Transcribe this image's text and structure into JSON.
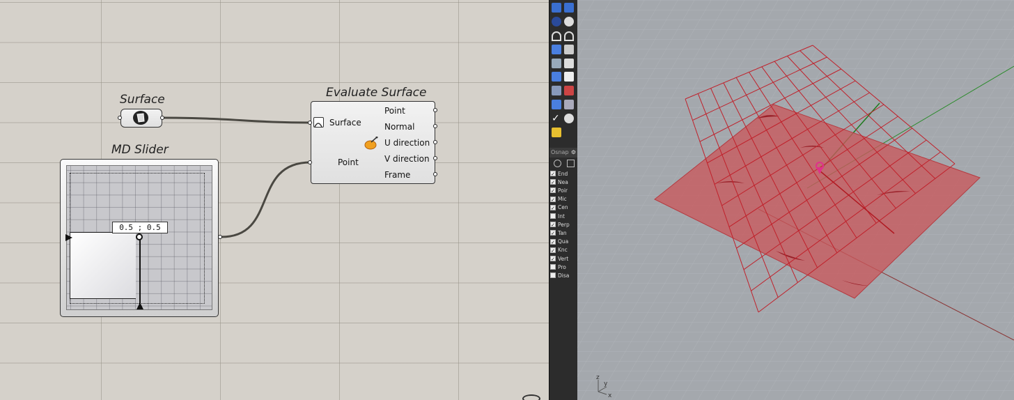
{
  "grasshopper": {
    "surface_component": {
      "title": "Surface"
    },
    "md_slider": {
      "title": "MD Slider",
      "value_text": "0.5 ; 0.5",
      "u_value": 0.5,
      "v_value": 0.5
    },
    "evaluate_surface": {
      "title": "Evaluate Surface",
      "inputs": [
        "Surface",
        "Point"
      ],
      "outputs": [
        "Point",
        "Normal",
        "U direction",
        "V direction",
        "Frame"
      ]
    }
  },
  "rhino": {
    "osnap": {
      "header": "Osnap",
      "items": [
        {
          "label": "End",
          "checked": true
        },
        {
          "label": "Nea",
          "checked": true
        },
        {
          "label": "Poir",
          "checked": true
        },
        {
          "label": "Mic",
          "checked": true
        },
        {
          "label": "Cen",
          "checked": true
        },
        {
          "label": "Int",
          "checked": false
        },
        {
          "label": "Perp",
          "checked": true
        },
        {
          "label": "Tan",
          "checked": true
        },
        {
          "label": "Qua",
          "checked": true
        },
        {
          "label": "Knc",
          "checked": true
        },
        {
          "label": "Vert",
          "checked": true
        },
        {
          "label": "Pro",
          "checked": false
        },
        {
          "label": "Disa",
          "checked": false
        }
      ]
    },
    "viewport": {
      "axis_labels": {
        "z": "z",
        "y": "y",
        "x": "x"
      }
    }
  },
  "colors": {
    "canvas_bg": "#d5d1ca",
    "surface_fill": "#c9585c",
    "grid_red": "#c0202a",
    "toolbar_bg": "#2c2c2c",
    "viewport_bg": "#a4a8ad",
    "point_marker": "#e0308c"
  }
}
